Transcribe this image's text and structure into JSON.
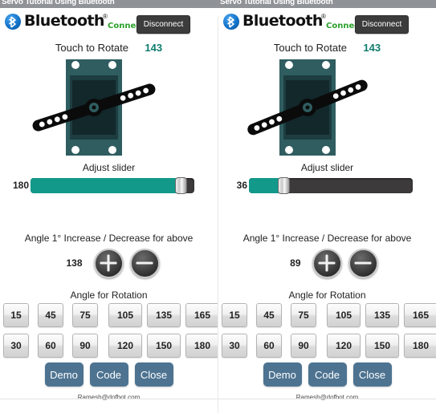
{
  "window": {
    "title": "Servo Tutorial Using Bluetooth"
  },
  "colors": {
    "accent_teal": "#12998a",
    "connected_green": "#2aa02a",
    "button_blue": "#4d7391",
    "titlebar_gray": "#8f9296",
    "slider_track": "#3c3a3a"
  },
  "panels": [
    {
      "id": "left",
      "header": {
        "brand": "Bluetooth",
        "registered_mark": "®",
        "status": "Connected",
        "disconnect_label": "Disconnect"
      },
      "rotate": {
        "label": "Touch to Rotate",
        "value": "143"
      },
      "servo": {
        "horn_angle_deg": 72
      },
      "slider": {
        "title": "Adjust slider",
        "value": "180",
        "percent": 95
      },
      "increment": {
        "title": "Angle 1° Increase / Decrease for above",
        "value": "138",
        "plus_label": "+",
        "minus_label": "−"
      },
      "angle_grid": {
        "title": "Angle for Rotation",
        "row1": [
          "15",
          "45",
          "75",
          "105",
          "135",
          "165"
        ],
        "row2": [
          "30",
          "60",
          "90",
          "120",
          "150",
          "180"
        ]
      },
      "actions": [
        "Demo",
        "Code",
        "Close"
      ],
      "footer": "Ramesh@dofbot.com"
    },
    {
      "id": "right",
      "header": {
        "brand": "Bluetooth",
        "registered_mark": "®",
        "status": "Connected",
        "disconnect_label": "Disconnect"
      },
      "rotate": {
        "label": "Touch to Rotate",
        "value": "143"
      },
      "servo": {
        "horn_angle_deg": 68
      },
      "slider": {
        "title": "Adjust slider",
        "value": "36",
        "percent": 19
      },
      "increment": {
        "title": "Angle 1° Increase / Decrease for above",
        "value": "89",
        "plus_label": "+",
        "minus_label": "−"
      },
      "angle_grid": {
        "title": "Angle for Rotation",
        "row1": [
          "15",
          "45",
          "75",
          "105",
          "135",
          "165"
        ],
        "row2": [
          "30",
          "60",
          "90",
          "120",
          "150",
          "180"
        ]
      },
      "actions": [
        "Demo",
        "Code",
        "Close"
      ],
      "footer": "Ramesh@dofbot.com"
    }
  ]
}
